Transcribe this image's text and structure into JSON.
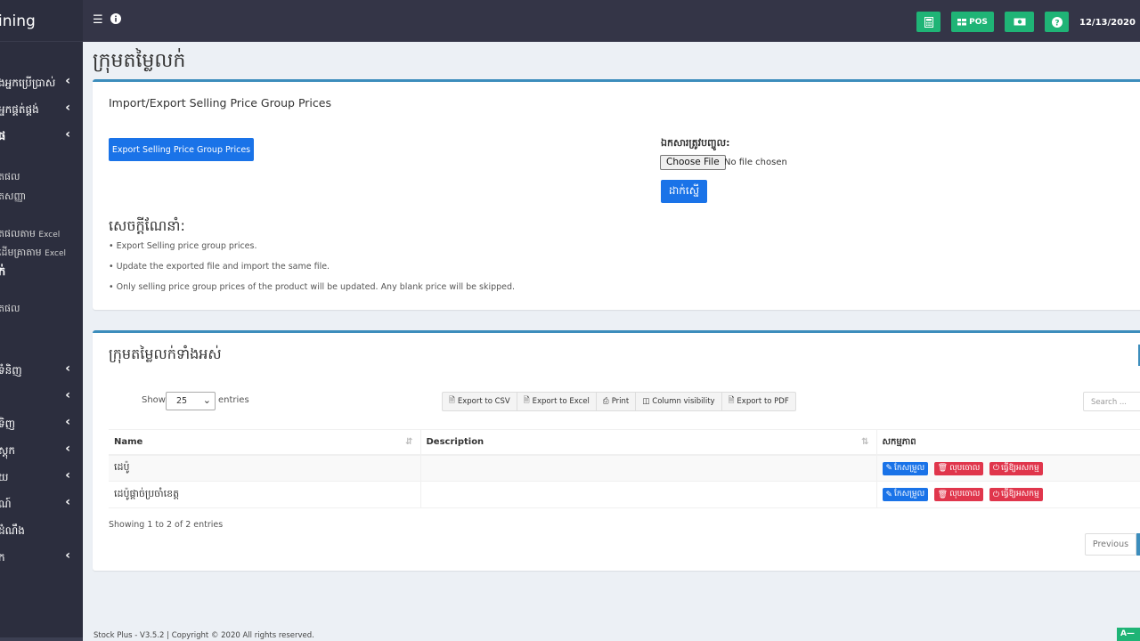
{
  "app": {
    "brand": "ining",
    "date": "12/13/2020"
  },
  "topbar": {
    "menu_icon": "hamburger-icon",
    "info_icon": "info-icon",
    "buttons": [
      {
        "icon": "calculator-icon",
        "label": ""
      },
      {
        "icon": "grid-icon",
        "label": "POS"
      },
      {
        "icon": "money-icon",
        "label": ""
      },
      {
        "icon": "question-icon",
        "label": ""
      }
    ]
  },
  "sidebar": {
    "items": [
      {
        "label": "ងអ្នកប្រើប្រាស់",
        "chevron": "‹"
      },
      {
        "label": "អ្នកផ្គត់ផ្គង់",
        "chevron": "‹"
      },
      {
        "label": "ផ",
        "chevron": "‹"
      },
      {
        "label": "ទំនិញ",
        "chevron": "‹"
      },
      {
        "label": "",
        "chevron": "‹"
      },
      {
        "label": "ទិញ",
        "chevron": "‹"
      },
      {
        "label": "ស្តុក",
        "chevron": "‹"
      },
      {
        "label": "យ",
        "chevron": "‹"
      },
      {
        "label": "ណ៍",
        "chevron": "‹"
      },
      {
        "label": "ដំណឹង",
        "chevron": ""
      },
      {
        "label": "ក",
        "chevron": "‹"
      }
    ],
    "subitems": [
      {
        "label": "តផល",
        "suffix": ""
      },
      {
        "label": "តសញ្ញា",
        "suffix": ""
      },
      {
        "label": "តផលតាម",
        "suffix": "Excel"
      },
      {
        "label": "ដើមគ្រាតាម",
        "suffix": "Excel"
      },
      {
        "label": "ក់",
        "suffix": ""
      },
      {
        "label": "តផល",
        "suffix": ""
      }
    ]
  },
  "page": {
    "title": "ក្រុមតម្លៃលក់"
  },
  "import_box": {
    "title": "Import/Export Selling Price Group Prices",
    "export_button": "Export Selling Price Group Prices",
    "file_label": "ឯកសារត្រូវបញ្ចូល:",
    "choose_file": "Choose File",
    "no_file": "No file chosen",
    "submit": "ដាក់ស្នើ",
    "instructions_title": "សេចក្តីណែនាំ:",
    "instructions": [
      "• Export Selling price group prices.",
      "• Update the exported file and import the same file.",
      "• Only selling price group prices of the product will be updated. Any blank price will be skipped."
    ]
  },
  "list_box": {
    "title": "ក្រុមតម្លៃលក់ទាំងអស់",
    "show_label": "Show",
    "page_size": "25",
    "entries_label": "entries",
    "export_buttons": [
      "Export to CSV",
      "Export to Excel",
      "Print",
      "Column visibility",
      "Export to PDF"
    ],
    "search_placeholder": "Search ...",
    "columns": [
      "Name",
      "Description",
      "សកម្មភាព"
    ],
    "rows": [
      {
        "name": "ដេប៉ូ",
        "description": ""
      },
      {
        "name": "ដេប៉ូផ្តាច់ប្រចាំខេត្ត",
        "description": ""
      }
    ],
    "actions": {
      "edit": "កែសម្រួល",
      "delete": "លុបចោល",
      "deactivate": "ធ្វើឱ្យអសកម្ម"
    },
    "showing": "Showing 1 to 2 of 2 entries",
    "previous": "Previous"
  },
  "footer": {
    "text": "Stock Plus - V3.5.2 | Copyright © 2020 All rights reserved.",
    "badge": "A—"
  }
}
